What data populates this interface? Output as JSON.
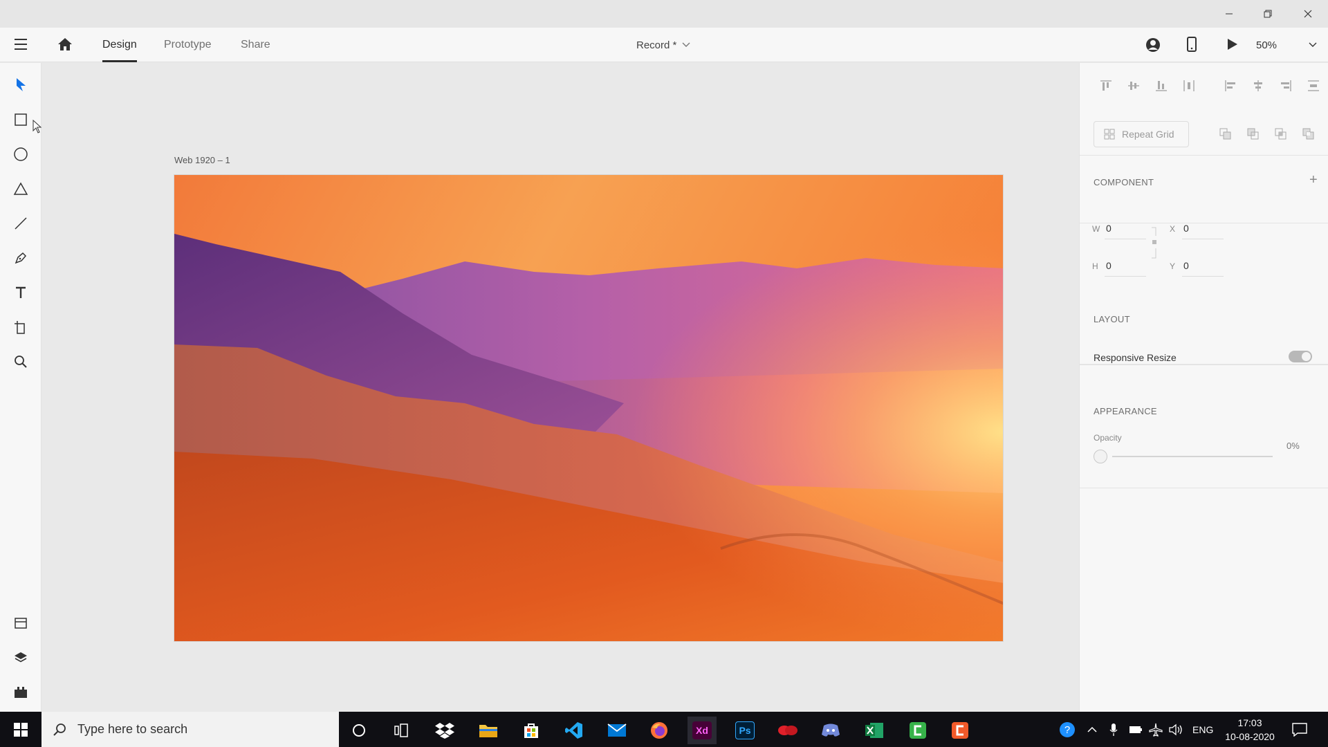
{
  "appbar": {
    "tabs": [
      {
        "label": "Design",
        "active": true
      },
      {
        "label": "Prototype",
        "active": false
      },
      {
        "label": "Share",
        "active": false
      }
    ],
    "document_title": "Record *",
    "zoom": "50%"
  },
  "canvas": {
    "artboard_label": "Web 1920 – 1"
  },
  "panel": {
    "repeat_grid": "Repeat Grid",
    "component_heading": "COMPONENT",
    "component_add": "+",
    "w_label": "W",
    "w_value": "0",
    "h_label": "H",
    "h_value": "0",
    "x_label": "X",
    "x_value": "0",
    "y_label": "Y",
    "y_value": "0",
    "layout_heading": "LAYOUT",
    "responsive_resize": "Responsive Resize",
    "appearance_heading": "APPEARANCE",
    "opacity_label": "Opacity",
    "opacity_value": "0%"
  },
  "taskbar": {
    "search_placeholder": "Type here to search",
    "language": "ENG",
    "time": "17:03",
    "date": "10-08-2020",
    "apps": [
      "cortana",
      "task-view",
      "dropbox",
      "file-explorer",
      "store",
      "visual-studio-code",
      "mail",
      "firefox",
      "adobe-xd",
      "photoshop",
      "app-red",
      "discord",
      "excel",
      "camtasia",
      "app-orange"
    ],
    "xd_label": "Xd",
    "ps_label": "Ps"
  },
  "colors": {
    "accent": "#1473e6",
    "xd": "#470137",
    "xd_text": "#ff61f6",
    "ps": "#001e36",
    "ps_text": "#31a8ff"
  }
}
